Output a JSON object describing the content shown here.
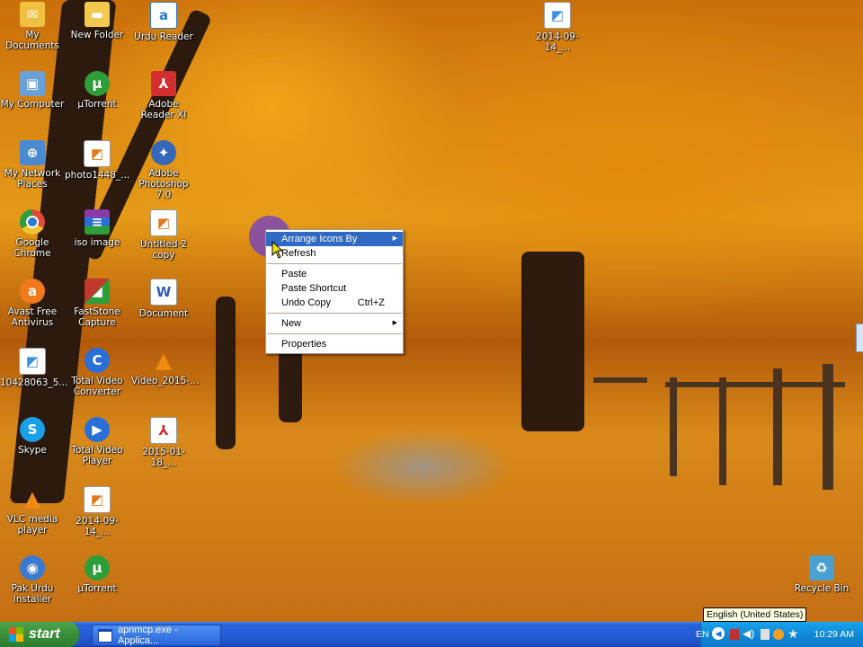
{
  "desktop_icons": [
    {
      "label": "My Documents",
      "icon": "my-documents-icon",
      "color": "#f0c040"
    },
    {
      "label": "New Folder",
      "icon": "folder-icon",
      "color": "#f2c94c"
    },
    {
      "label": "Urdu Reader",
      "icon": "urdu-reader-icon",
      "color": "#2a7bd6"
    },
    {
      "label": "2014-09-14_...",
      "icon": "image-file-icon",
      "color": "#3a8fe0"
    },
    {
      "label": "My Computer",
      "icon": "my-computer-icon",
      "color": "#6aa0d8"
    },
    {
      "label": "µTorrent",
      "icon": "utorrent-icon",
      "color": "#2e9e3a"
    },
    {
      "label": "Adobe Reader XI",
      "icon": "adobe-reader-icon",
      "color": "#d32f2f"
    },
    {
      "label": "My Network Places",
      "icon": "network-places-icon",
      "color": "#4a8ad0"
    },
    {
      "label": "photo1448_...",
      "icon": "image-file-icon",
      "color": "#e07a20"
    },
    {
      "label": "Adobe Photoshop 7.0",
      "icon": "photoshop-icon",
      "color": "#3568b8"
    },
    {
      "label": "Google Chrome",
      "icon": "chrome-icon",
      "color": "#e04a3a"
    },
    {
      "label": "iso image",
      "icon": "winrar-archive-icon",
      "color": "#8a3aa8"
    },
    {
      "label": "Untitled-2 copy",
      "icon": "image-file-icon",
      "color": "#e07a20"
    },
    {
      "label": "Avast Free Antivirus",
      "icon": "avast-icon",
      "color": "#f07a1a"
    },
    {
      "label": "FastStone Capture",
      "icon": "faststone-icon",
      "color": "#c0392b"
    },
    {
      "label": "Document",
      "icon": "word-document-icon",
      "color": "#2b5cb8"
    },
    {
      "label": "10428063_5...",
      "icon": "image-file-icon",
      "color": "#3a8fe0"
    },
    {
      "label": "Total Video Converter",
      "icon": "video-converter-icon",
      "color": "#2a6fd8"
    },
    {
      "label": "Video_2015-...",
      "icon": "vlc-file-icon",
      "color": "#f08a10"
    },
    {
      "label": "Skype",
      "icon": "skype-icon",
      "color": "#1aa0e8"
    },
    {
      "label": "Total Video Player",
      "icon": "video-player-icon",
      "color": "#2a6fd8"
    },
    {
      "label": "2015-01-18_...",
      "icon": "pdf-file-icon",
      "color": "#d32f2f"
    },
    {
      "label": "VLC media player",
      "icon": "vlc-icon",
      "color": "#f08a10"
    },
    {
      "label": "2014-09-14_...",
      "icon": "image-file-icon",
      "color": "#e07a20"
    },
    {
      "label": "Pak Urdu Installer",
      "icon": "installer-icon",
      "color": "#3a7bd0"
    },
    {
      "label": "µTorrent",
      "icon": "utorrent-icon",
      "color": "#2e9e3a"
    },
    {
      "label": "Recycle Bin",
      "icon": "recycle-bin-icon",
      "color": "#4aa0d0"
    }
  ],
  "context_menu": {
    "items": [
      {
        "label": "Arrange Icons By",
        "has_submenu": true,
        "highlighted": true
      },
      {
        "label": "Refresh"
      },
      {
        "label": "Paste"
      },
      {
        "label": "Paste Shortcut"
      },
      {
        "label": "Undo Copy",
        "shortcut": "Ctrl+Z"
      },
      {
        "label": "New",
        "has_submenu": true
      },
      {
        "label": "Properties"
      }
    ]
  },
  "taskbar": {
    "start_label": "start",
    "task_label": "apnmcp.exe - Applica...",
    "language": "EN",
    "clock": "10:29 AM"
  },
  "tooltip": "English (United States)",
  "colors": {
    "highlight": "#316ac5",
    "taskbar": "#245ed8",
    "start": "#3a8f3a"
  }
}
